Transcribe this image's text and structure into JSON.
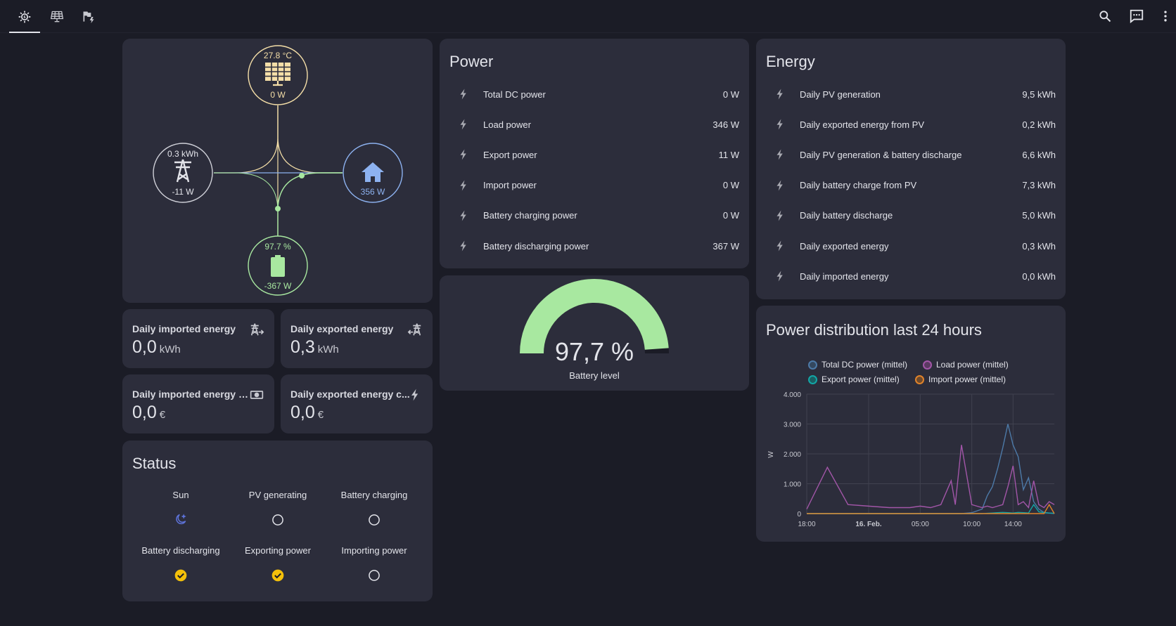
{
  "topbar": {
    "tabs": [
      {
        "icon": "solar-power-icon",
        "active": true
      },
      {
        "icon": "solar-panel-icon",
        "active": false
      },
      {
        "icon": "flash-flag-icon",
        "active": false
      }
    ],
    "actions": [
      "search-icon",
      "assist-chat-icon",
      "more-vert-icon"
    ]
  },
  "flow": {
    "solar": {
      "top": "27.8 °C",
      "bottom": "0 W"
    },
    "grid": {
      "top": "0.3 kWh",
      "bottom": "-11 W"
    },
    "home": {
      "bottom": "356 W"
    },
    "battery": {
      "top": "97.7 %",
      "bottom": "-367 W"
    },
    "colors": {
      "solar": "#f5dfa8",
      "grid": "#cfd0d8",
      "home": "#8db2f0",
      "battery": "#a8e8a0"
    }
  },
  "power": {
    "title": "Power",
    "rows": [
      {
        "label": "Total DC power",
        "value": "0 W"
      },
      {
        "label": "Load power",
        "value": "346 W"
      },
      {
        "label": "Export power",
        "value": "11 W"
      },
      {
        "label": "Import power",
        "value": "0 W"
      },
      {
        "label": "Battery charging power",
        "value": "0 W"
      },
      {
        "label": "Battery discharging power",
        "value": "367 W"
      }
    ]
  },
  "energy": {
    "title": "Energy",
    "rows": [
      {
        "label": "Daily PV generation",
        "value": "9,5 kWh"
      },
      {
        "label": "Daily exported energy from PV",
        "value": "0,2 kWh"
      },
      {
        "label": "Daily PV generation & battery discharge",
        "value": "6,6 kWh"
      },
      {
        "label": "Daily battery charge from PV",
        "value": "7,3 kWh"
      },
      {
        "label": "Daily battery discharge",
        "value": "5,0 kWh"
      },
      {
        "label": "Daily exported energy",
        "value": "0,3 kWh"
      },
      {
        "label": "Daily imported energy",
        "value": "0,0 kWh"
      }
    ]
  },
  "tiles": [
    {
      "name": "Daily imported energy",
      "value": "0,0",
      "unit": "kWh",
      "icon": "transmission-tower-import-icon"
    },
    {
      "name": "Daily exported energy",
      "value": "0,3",
      "unit": "kWh",
      "icon": "transmission-tower-export-icon"
    },
    {
      "name": "Daily imported energy c...",
      "value": "0,0",
      "unit": "€",
      "icon": "cash-icon"
    },
    {
      "name": "Daily exported energy c...",
      "value": "0,0",
      "unit": "€",
      "icon": "flash-icon"
    }
  ],
  "gauge": {
    "value_text": "97,7 %",
    "label": "Battery level",
    "fraction": 0.977,
    "color": "#a8e8a0"
  },
  "status": {
    "title": "Status",
    "items": [
      {
        "label": "Sun",
        "state": "night"
      },
      {
        "label": "PV generating",
        "state": "off"
      },
      {
        "label": "Battery charging",
        "state": "off"
      },
      {
        "label": "Battery discharging",
        "state": "on"
      },
      {
        "label": "Exporting power",
        "state": "on"
      },
      {
        "label": "Importing power",
        "state": "off"
      }
    ]
  },
  "history": {
    "title": "Power distribution last 24 hours",
    "legend": [
      {
        "name": "Total DC power (mittel)",
        "color": "#4d7aa8"
      },
      {
        "name": "Load power (mittel)",
        "color": "#a256a8"
      },
      {
        "name": "Export power (mittel)",
        "color": "#12a6a6"
      },
      {
        "name": "Import power (mittel)",
        "color": "#e0832a"
      }
    ]
  },
  "chart_data": {
    "type": "line",
    "title": "Power distribution last 24 hours",
    "ylabel": "W",
    "ylim": [
      0,
      4000
    ],
    "yticks": [
      "0",
      "1.000",
      "2.000",
      "3.000",
      "4.000"
    ],
    "xticks": [
      "18:00",
      "16. Feb.",
      "05:00",
      "10:00",
      "14:00"
    ],
    "x_hours": [
      0,
      2,
      4,
      6,
      8,
      10,
      11,
      12,
      13,
      14,
      14.4,
      15,
      16,
      17,
      17.5,
      18,
      18.5,
      19,
      19.5,
      20,
      20.5,
      21,
      21.5,
      22,
      22.5,
      23,
      23.5,
      24
    ],
    "series": [
      {
        "name": "Total DC power (mittel)",
        "values": [
          0,
          0,
          0,
          0,
          0,
          0,
          0,
          0,
          0,
          0,
          0,
          0,
          30,
          150,
          600,
          900,
          1500,
          2200,
          3000,
          2300,
          1900,
          800,
          1200,
          400,
          150,
          40,
          20,
          0
        ]
      },
      {
        "name": "Load power (mittel)",
        "values": [
          150,
          1550,
          300,
          250,
          200,
          200,
          250,
          200,
          300,
          1100,
          300,
          2300,
          300,
          200,
          250,
          200,
          250,
          300,
          900,
          1600,
          300,
          400,
          200,
          1100,
          300,
          200,
          400,
          300
        ]
      },
      {
        "name": "Export power (mittel)",
        "values": [
          0,
          0,
          0,
          0,
          0,
          0,
          0,
          0,
          0,
          0,
          0,
          0,
          0,
          0,
          10,
          20,
          30,
          40,
          30,
          20,
          40,
          30,
          20,
          300,
          60,
          30,
          20,
          10
        ]
      },
      {
        "name": "Import power (mittel)",
        "values": [
          0,
          0,
          0,
          0,
          0,
          0,
          0,
          0,
          0,
          0,
          0,
          0,
          0,
          0,
          0,
          0,
          0,
          0,
          0,
          0,
          0,
          0,
          0,
          0,
          0,
          0,
          300,
          0
        ]
      }
    ]
  }
}
